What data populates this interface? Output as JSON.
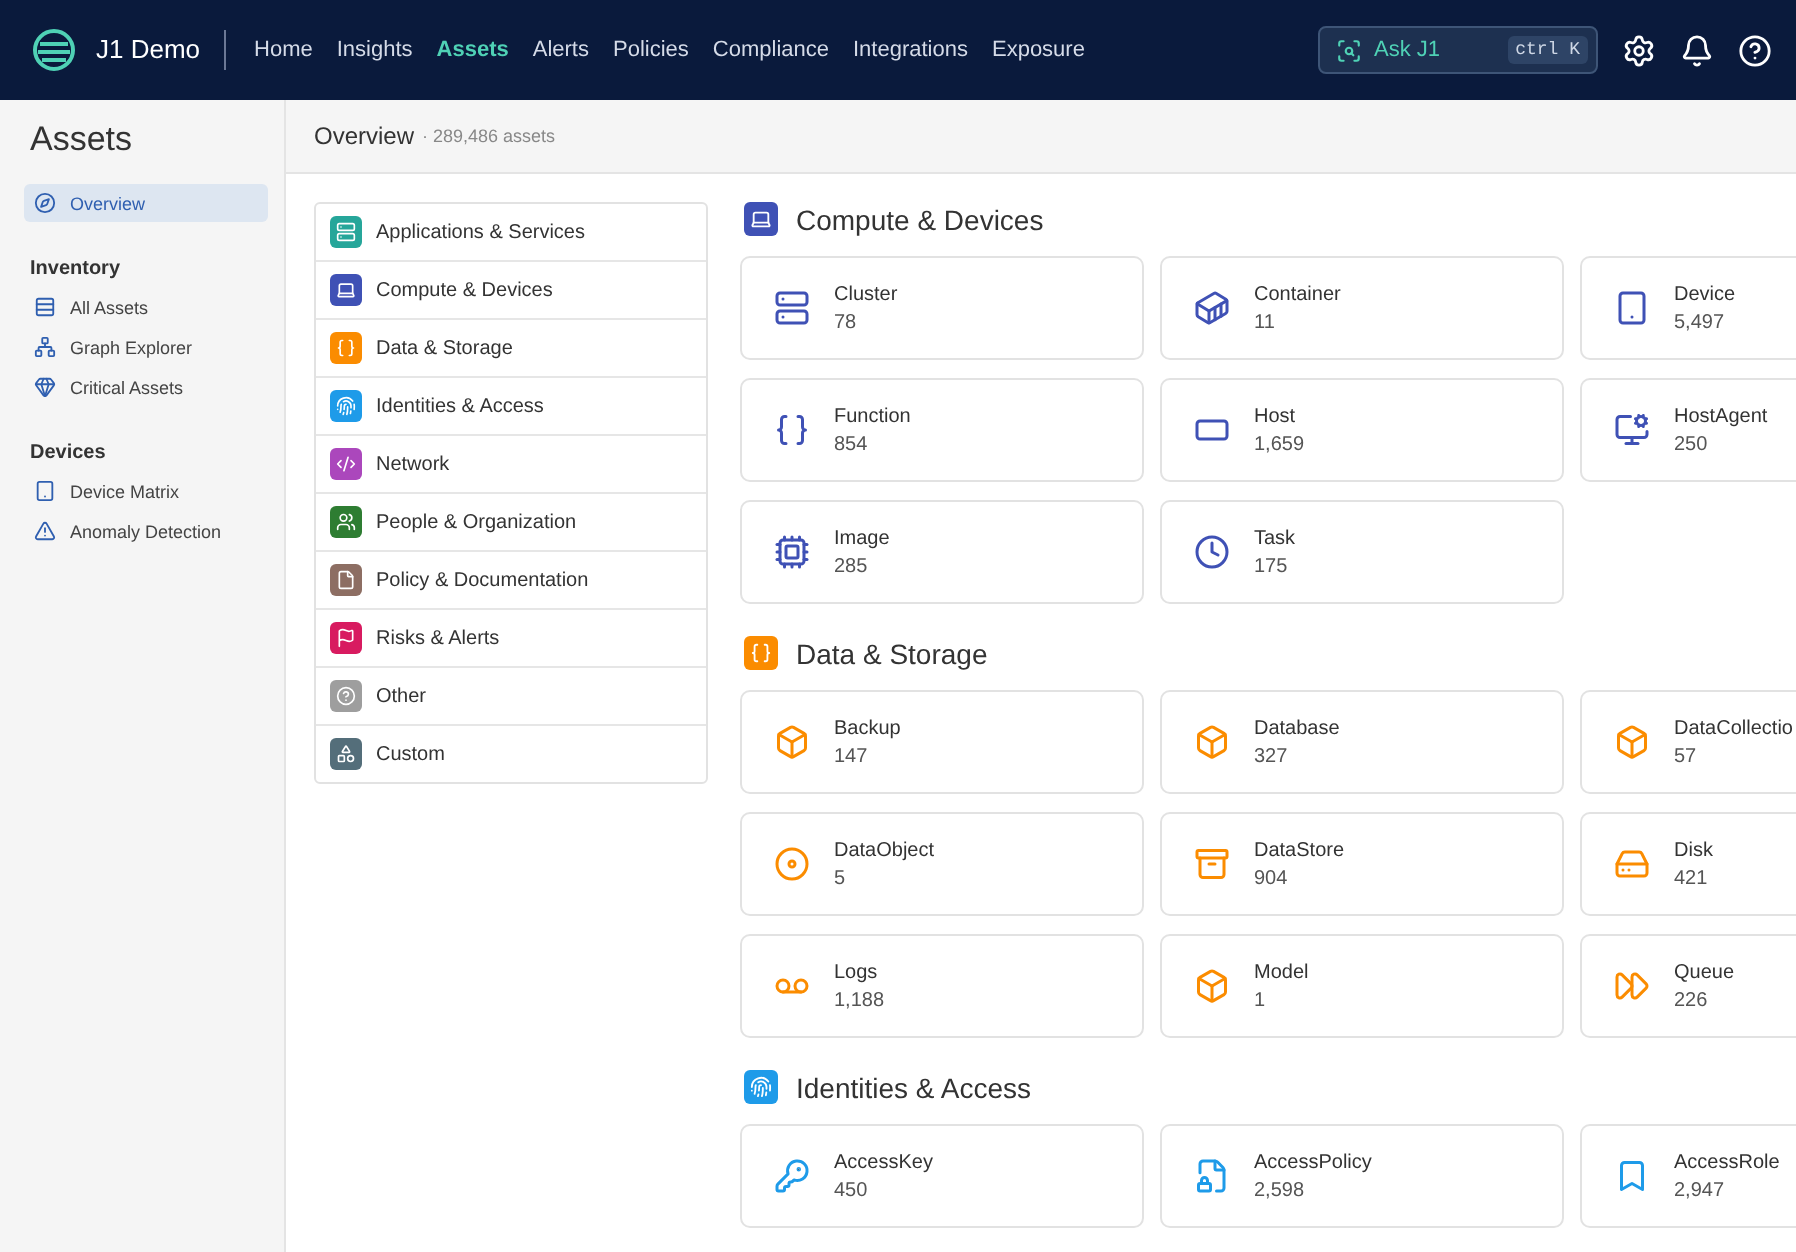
{
  "app": {
    "name": "J1 Demo"
  },
  "nav": [
    {
      "label": "Home",
      "selected": false
    },
    {
      "label": "Insights",
      "selected": false
    },
    {
      "label": "Assets",
      "selected": true
    },
    {
      "label": "Alerts",
      "selected": false
    },
    {
      "label": "Policies",
      "selected": false
    },
    {
      "label": "Compliance",
      "selected": false
    },
    {
      "label": "Integrations",
      "selected": false
    },
    {
      "label": "Exposure",
      "selected": false
    }
  ],
  "search": {
    "label": "Ask J1",
    "shortcut": "ctrl K"
  },
  "sidebar": {
    "title": "Assets",
    "items": [
      {
        "label": "Overview",
        "selected": true
      }
    ],
    "groups": [
      {
        "title": "Inventory",
        "items": [
          {
            "label": "All Assets",
            "selected": false
          },
          {
            "label": "Graph Explorer",
            "selected": false
          },
          {
            "label": "Critical Assets",
            "selected": false
          }
        ]
      },
      {
        "title": "Devices",
        "items": [
          {
            "label": "Device Matrix",
            "selected": false
          },
          {
            "label": "Anomaly Detection",
            "selected": false
          }
        ]
      }
    ]
  },
  "header": {
    "title": "Overview",
    "count": "· 289,486 assets"
  },
  "categories": [
    {
      "label": "Applications & Services",
      "color": "#26a69a"
    },
    {
      "label": "Compute & Devices",
      "color": "#3f51b5"
    },
    {
      "label": "Data & Storage",
      "color": "#fb8c00"
    },
    {
      "label": "Identities & Access",
      "color": "#1e9be9"
    },
    {
      "label": "Network",
      "color": "#ab47bc"
    },
    {
      "label": "People & Organization",
      "color": "#2e7d32"
    },
    {
      "label": "Policy & Documentation",
      "color": "#8d6e63"
    },
    {
      "label": "Risks & Alerts",
      "color": "#d81b60"
    },
    {
      "label": "Other",
      "color": "#9e9e9e"
    },
    {
      "label": "Custom",
      "color": "#546e7a"
    }
  ],
  "sections": [
    {
      "title": "Compute & Devices",
      "color": "#3f51b5",
      "cards": [
        {
          "name": "Cluster",
          "count": "78"
        },
        {
          "name": "Container",
          "count": "11"
        },
        {
          "name": "Device",
          "count": "5,497"
        },
        {
          "name": "Function",
          "count": "854"
        },
        {
          "name": "Host",
          "count": "1,659"
        },
        {
          "name": "HostAgent",
          "count": "250"
        },
        {
          "name": "Image",
          "count": "285"
        },
        {
          "name": "Task",
          "count": "175"
        }
      ]
    },
    {
      "title": "Data & Storage",
      "color": "#fb8c00",
      "cards": [
        {
          "name": "Backup",
          "count": "147"
        },
        {
          "name": "Database",
          "count": "327"
        },
        {
          "name": "DataCollectio",
          "count": "57"
        },
        {
          "name": "DataObject",
          "count": "5"
        },
        {
          "name": "DataStore",
          "count": "904"
        },
        {
          "name": "Disk",
          "count": "421"
        },
        {
          "name": "Logs",
          "count": "1,188"
        },
        {
          "name": "Model",
          "count": "1"
        },
        {
          "name": "Queue",
          "count": "226"
        }
      ]
    },
    {
      "title": "Identities & Access",
      "color": "#1e9be9",
      "cards": [
        {
          "name": "AccessKey",
          "count": "450"
        },
        {
          "name": "AccessPolicy",
          "count": "2,598"
        },
        {
          "name": "AccessRole",
          "count": "2,947"
        }
      ]
    }
  ]
}
